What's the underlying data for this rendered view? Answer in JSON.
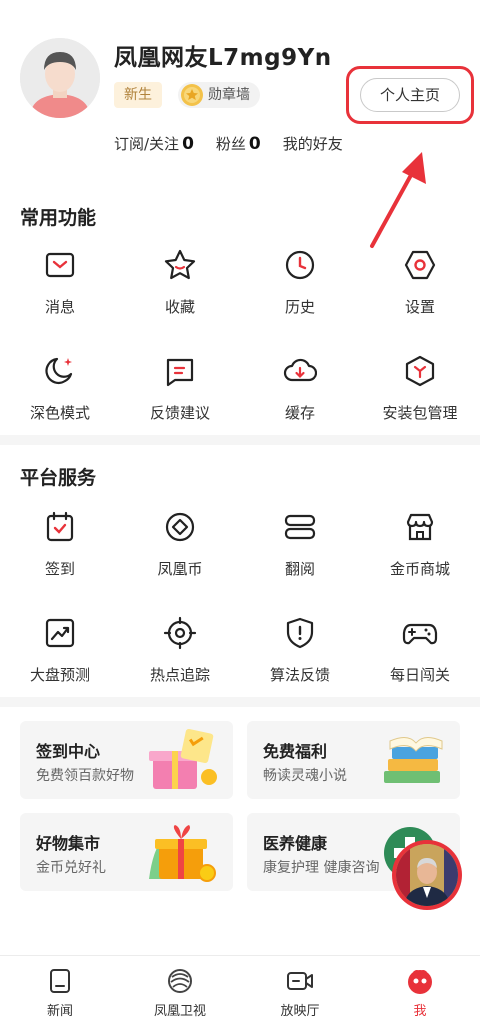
{
  "profile": {
    "username": "凤凰网友L7mg9Yn",
    "badge_new": "新生",
    "badge_medal": "勋章墙",
    "home_button": "个人主页",
    "stats": [
      {
        "label": "订阅/关注",
        "value": "0"
      },
      {
        "label": "粉丝",
        "value": "0"
      },
      {
        "label": "我的好友",
        "value": ""
      }
    ]
  },
  "common": {
    "title": "常用功能",
    "items": [
      {
        "label": "消息",
        "icon": "message-icon"
      },
      {
        "label": "收藏",
        "icon": "star-icon"
      },
      {
        "label": "历史",
        "icon": "clock-icon"
      },
      {
        "label": "设置",
        "icon": "gear-icon"
      },
      {
        "label": "深色模式",
        "icon": "moon-icon"
      },
      {
        "label": "反馈建议",
        "icon": "feedback-icon"
      },
      {
        "label": "缓存",
        "icon": "cloud-download-icon"
      },
      {
        "label": "安装包管理",
        "icon": "package-icon"
      }
    ]
  },
  "platform": {
    "title": "平台服务",
    "items": [
      {
        "label": "签到",
        "icon": "checkin-icon"
      },
      {
        "label": "凤凰币",
        "icon": "coin-icon"
      },
      {
        "label": "翻阅",
        "icon": "flip-icon"
      },
      {
        "label": "金币商城",
        "icon": "store-icon"
      },
      {
        "label": "大盘预测",
        "icon": "trend-icon"
      },
      {
        "label": "热点追踪",
        "icon": "target-icon"
      },
      {
        "label": "算法反馈",
        "icon": "shield-icon"
      },
      {
        "label": "每日闯关",
        "icon": "gamepad-icon"
      }
    ]
  },
  "cards": [
    {
      "title": "签到中心",
      "subtitle": "免费领百款好物"
    },
    {
      "title": "免费福利",
      "subtitle": "畅读灵魂小说"
    },
    {
      "title": "好物集市",
      "subtitle": "金币兑好礼"
    },
    {
      "title": "医养健康",
      "subtitle": "康复护理 健康咨询"
    }
  ],
  "tabs": [
    {
      "label": "新闻",
      "icon": "news-icon"
    },
    {
      "label": "凤凰卫视",
      "icon": "phoenix-logo-icon"
    },
    {
      "label": "放映厅",
      "icon": "video-icon"
    },
    {
      "label": "我",
      "icon": "me-icon"
    }
  ],
  "colors": {
    "accent": "#e8323a",
    "badge_bg": "#fdf1dc",
    "card_bg": "#f5f5f5"
  }
}
